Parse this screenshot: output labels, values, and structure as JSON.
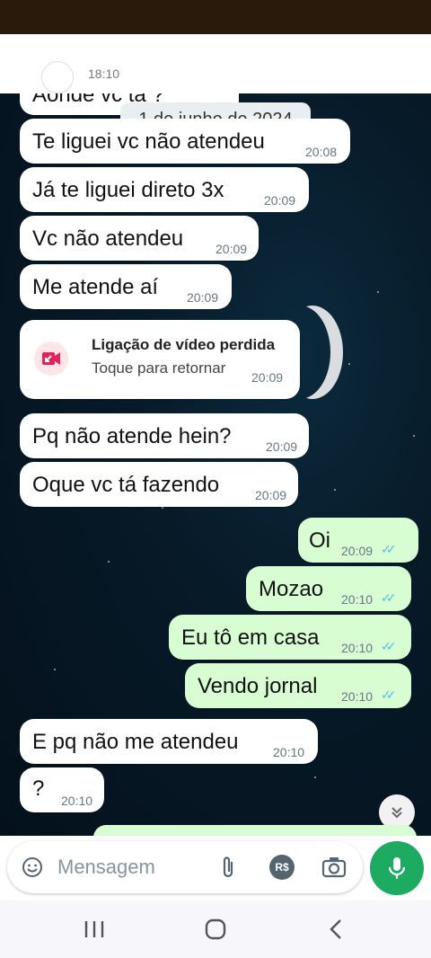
{
  "header": {
    "prev_time_partial": "18:10",
    "prev_message_partial": "Aonde vc tá ?"
  },
  "date_divider": "1 de junho de 2024",
  "messages": [
    {
      "dir": "in",
      "text": "Te liguei vc não atendeu",
      "time": "20:08"
    },
    {
      "dir": "in",
      "text": "Já te liguei direto 3x",
      "time": "20:09"
    },
    {
      "dir": "in",
      "text": "Vc não atendeu",
      "time": "20:09"
    },
    {
      "dir": "in",
      "text": "Me atende aí",
      "time": "20:09"
    },
    {
      "dir": "in",
      "text": "Pq não atende hein?",
      "time": "20:09"
    },
    {
      "dir": "in",
      "text": "Oque vc tá fazendo",
      "time": "20:09"
    },
    {
      "dir": "out",
      "text": "Oi",
      "time": "20:09"
    },
    {
      "dir": "out",
      "text": "Mozao",
      "time": "20:10"
    },
    {
      "dir": "out",
      "text": "Eu tô em casa",
      "time": "20:10"
    },
    {
      "dir": "out",
      "text": "Vendo jornal",
      "time": "20:10"
    },
    {
      "dir": "in",
      "text": "E pq não me atendeu",
      "time": "20:10"
    },
    {
      "dir": "in",
      "text": "?",
      "time": "20:10"
    }
  ],
  "missed_call": {
    "title": "Ligação de vídeo perdida",
    "subtitle": "Toque para retornar",
    "time": "20:09"
  },
  "composer": {
    "placeholder": "Mensagem",
    "payment_label": "R$"
  },
  "colors": {
    "outgoing": "#d9fdd3",
    "incoming": "#ffffff",
    "accent": "#1daa61",
    "read_ticks": "#53bdeb",
    "missed_call": "#e0245e"
  },
  "icons": [
    "emoji-icon",
    "attach-icon",
    "payment-icon",
    "camera-icon",
    "mic-icon",
    "scroll-down-icon",
    "missed-video-call-icon",
    "recent-apps-icon",
    "home-icon",
    "back-icon"
  ]
}
